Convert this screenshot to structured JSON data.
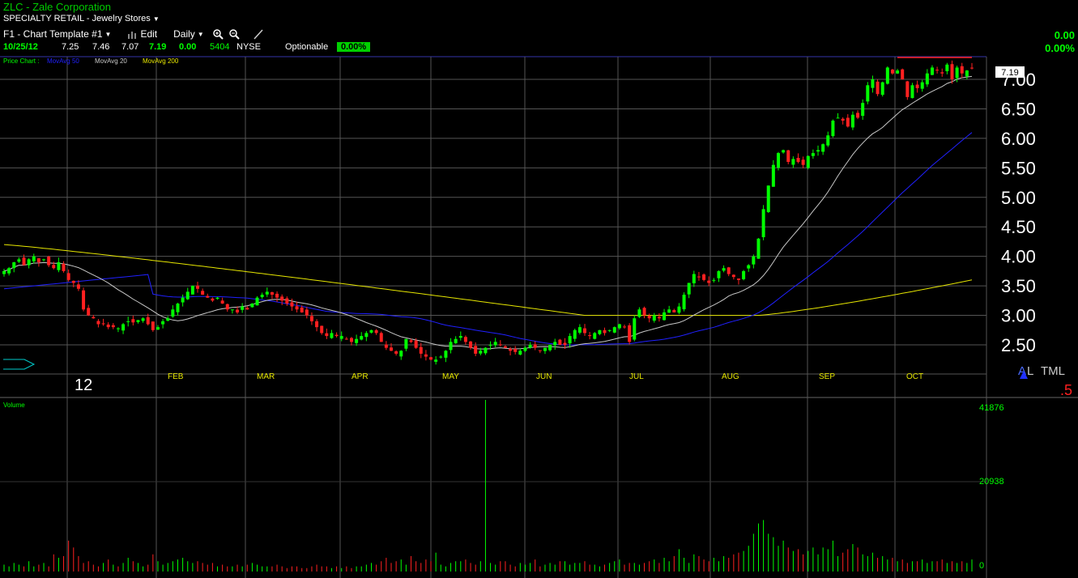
{
  "header": {
    "title": "ZLC - Zale Corporation",
    "sector": "SPECIALTY RETAIL - Jewelry Stores",
    "template_label": "F1 - Chart Template #1",
    "edit_label": "Edit",
    "interval_label": "Daily"
  },
  "quote": {
    "date": "10/25/12",
    "open": "7.25",
    "high": "7.46",
    "low": "7.07",
    "close": "7.19",
    "change": "0.00",
    "volume": "5404",
    "exchange": "NYSE",
    "optionable_label": "Optionable",
    "optionable_pct": "0.00%"
  },
  "right_change": {
    "change": "0.00",
    "pct": "0.00%"
  },
  "price_pane": {
    "legend": {
      "label": "Price Chart :",
      "ma50": "MovAvg 50",
      "ma20": "MovAvg 20",
      "ma200": "MovAvg 200"
    },
    "last_price_tag": "7.19",
    "year_label": "12",
    "corner_labels": {
      "a": "A",
      "l": "L",
      "tml": "TML",
      "five": ".5"
    }
  },
  "volume_pane": {
    "label": "Volume",
    "ticks": [
      "41876",
      "20938",
      "0"
    ]
  },
  "colors": {
    "up": "#00ff00",
    "down": "#ff2020",
    "ma20": "#c8c8c8",
    "ma50": "#2020ff",
    "ma200": "#e6e600",
    "grid": "#555555",
    "text_green": "#00ff00"
  },
  "chart_data": {
    "type": "candlestick",
    "title": "ZLC - Zale Corporation",
    "x_axis": {
      "months": [
        "12",
        "FEB",
        "MAR",
        "APR",
        "MAY",
        "JUN",
        "JUL",
        "AUG",
        "SEP",
        "OCT"
      ]
    },
    "y_axis": {
      "ticks": [
        "7.00",
        "6.50",
        "6.00",
        "5.50",
        "5.00",
        "4.50",
        "4.00",
        "3.50",
        "3.00",
        "2.50"
      ],
      "range": [
        2.25,
        7.4
      ]
    },
    "close_series": [
      3.75,
      3.8,
      3.9,
      3.95,
      3.85,
      3.95,
      4.0,
      3.9,
      3.95,
      3.85,
      3.8,
      3.9,
      3.75,
      3.6,
      3.55,
      3.45,
      3.1,
      3.0,
      2.95,
      2.85,
      2.85,
      2.8,
      2.8,
      2.78,
      2.85,
      2.9,
      2.88,
      2.92,
      2.95,
      2.85,
      2.75,
      2.8,
      2.9,
      2.95,
      3.1,
      3.2,
      3.3,
      3.4,
      3.5,
      3.45,
      3.35,
      3.3,
      3.25,
      3.3,
      3.2,
      3.1,
      3.1,
      3.05,
      3.15,
      3.1,
      3.2,
      3.3,
      3.35,
      3.4,
      3.35,
      3.3,
      3.25,
      3.2,
      3.15,
      3.1,
      3.05,
      3.0,
      2.9,
      2.8,
      2.7,
      2.65,
      2.7,
      2.65,
      2.65,
      2.6,
      2.55,
      2.6,
      2.65,
      2.7,
      2.75,
      2.7,
      2.55,
      2.45,
      2.4,
      2.35,
      2.4,
      2.6,
      2.55,
      2.45,
      2.35,
      2.3,
      2.25,
      2.25,
      2.3,
      2.4,
      2.55,
      2.6,
      2.65,
      2.55,
      2.45,
      2.35,
      2.4,
      2.45,
      2.5,
      2.55,
      2.5,
      2.45,
      2.4,
      2.38,
      2.4,
      2.45,
      2.5,
      2.45,
      2.4,
      2.45,
      2.5,
      2.55,
      2.5,
      2.5,
      2.65,
      2.75,
      2.8,
      2.7,
      2.65,
      2.7,
      2.75,
      2.7,
      2.75,
      2.8,
      2.85,
      2.8,
      2.55,
      2.95,
      3.1,
      3.0,
      2.95,
      3.0,
      2.95,
      3.05,
      3.1,
      3.05,
      3.15,
      3.35,
      3.55,
      3.7,
      3.65,
      3.6,
      3.55,
      3.6,
      3.75,
      3.8,
      3.7,
      3.65,
      3.6,
      3.75,
      3.85,
      4.0,
      4.3,
      4.8,
      5.2,
      5.55,
      5.75,
      5.8,
      5.6,
      5.65,
      5.6,
      5.55,
      5.7,
      5.75,
      5.8,
      5.9,
      6.05,
      6.3,
      6.35,
      6.3,
      6.2,
      6.4,
      6.35,
      6.6,
      6.9,
      7.0,
      6.75,
      6.95,
      7.2,
      7.1,
      7.15,
      7.0,
      6.7,
      6.9,
      6.85,
      6.95,
      7.1,
      7.2,
      7.15,
      7.1,
      7.25,
      7.0,
      7.2,
      7.1,
      7.15,
      7.19
    ],
    "ma20_last": 7.0,
    "ma50_last": 5.9,
    "ma200_last": 3.6,
    "volume_series": [
      4,
      3,
      5,
      4,
      3,
      6,
      3,
      4,
      5,
      3,
      10,
      8,
      9,
      18,
      14,
      9,
      5,
      6,
      4,
      3,
      5,
      7,
      4,
      3,
      5,
      8,
      6,
      5,
      3,
      4,
      10,
      6,
      4,
      5,
      6,
      7,
      8,
      6,
      5,
      6,
      5,
      4,
      5,
      3,
      4,
      3,
      3,
      4,
      3,
      4,
      5,
      4,
      3,
      3,
      3,
      4,
      3,
      2,
      3,
      3,
      2,
      2,
      3,
      4,
      3,
      3,
      2,
      3,
      2,
      3,
      2,
      3,
      3,
      4,
      5,
      4,
      6,
      8,
      5,
      6,
      7,
      4,
      9,
      6,
      5,
      7,
      6,
      11,
      4,
      3,
      5,
      6,
      6,
      7,
      5,
      4,
      6,
      100,
      5,
      4,
      6,
      6,
      4,
      3,
      5,
      4,
      5,
      7,
      3,
      4,
      5,
      4,
      6,
      6,
      4,
      5,
      5,
      6,
      4,
      4,
      3,
      4,
      5,
      6,
      7,
      4,
      5,
      5,
      4,
      5,
      6,
      7,
      5,
      8,
      6,
      9,
      13,
      8,
      5,
      10,
      9,
      7,
      6,
      8,
      6,
      9,
      8,
      10,
      11,
      12,
      15,
      22,
      28,
      30,
      22,
      20,
      15,
      18,
      14,
      12,
      13,
      10,
      12,
      14,
      10,
      14,
      13,
      18,
      9,
      11,
      13,
      16,
      14,
      10,
      9,
      11,
      8,
      9,
      7,
      8,
      6,
      7,
      5,
      6,
      6,
      7,
      5,
      6,
      6,
      7,
      5,
      6,
      5,
      6,
      5,
      7,
      6,
      5,
      5
    ]
  }
}
